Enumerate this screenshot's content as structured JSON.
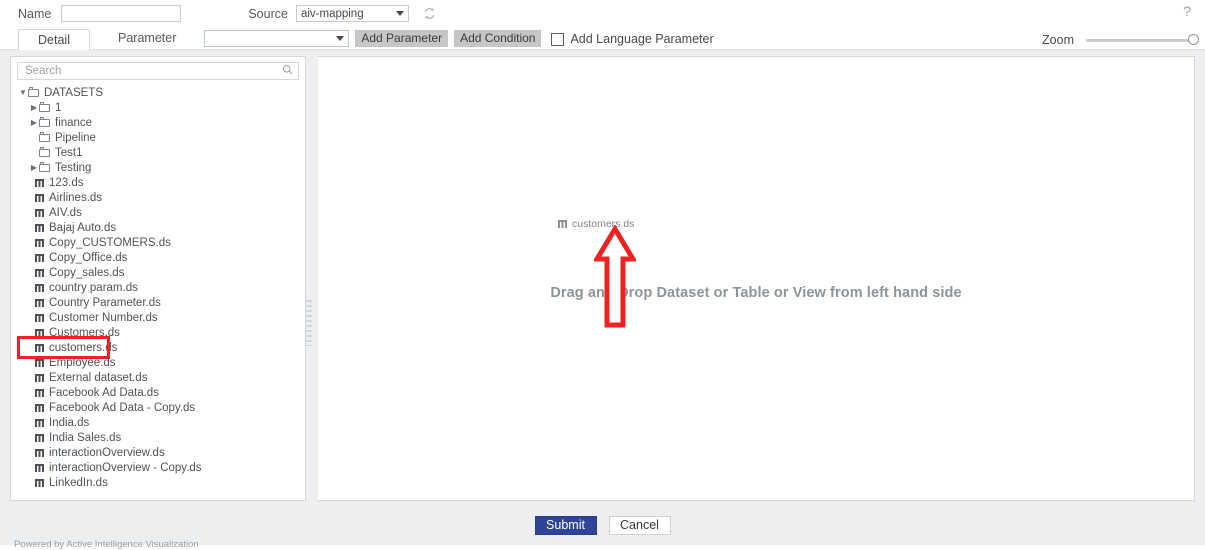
{
  "window": {
    "help_icon": "question-mark-icon",
    "powered_by": "Powered by Active Intelligence Visualization"
  },
  "topbar": {
    "name_label": "Name",
    "name_value": "",
    "name_placeholder": "",
    "source_label": "Source",
    "source_value": "aiv-mapping",
    "refresh_icon": "refresh-icon"
  },
  "tabs": {
    "detail_label": "Detail",
    "parameter_label": "Parameter",
    "parameter_select_value": "",
    "add_parameter_label": "Add Parameter",
    "add_condition_label": "Add Condition",
    "add_language_parameter_label": "Add Language Parameter",
    "add_language_parameter_checked": false
  },
  "zoom": {
    "label": "Zoom",
    "value": 100
  },
  "tree": {
    "search_placeholder": "Search",
    "search_value": "",
    "search_icon": "search-icon",
    "nodes": [
      {
        "label": "DATASETS",
        "type": "folder",
        "level": 0,
        "twist": "v"
      },
      {
        "label": "1",
        "type": "folder",
        "level": 1,
        "twist": ">"
      },
      {
        "label": "finance",
        "type": "folder",
        "level": 1,
        "twist": ">"
      },
      {
        "label": "Pipeline",
        "type": "folder",
        "level": 1,
        "twist": ""
      },
      {
        "label": "Test1",
        "type": "folder",
        "level": 1,
        "twist": ""
      },
      {
        "label": "Testing",
        "type": "folder",
        "level": 1,
        "twist": ">"
      },
      {
        "label": "123.ds",
        "type": "dataset",
        "level": 1,
        "twist": ""
      },
      {
        "label": "Airlines.ds",
        "type": "dataset",
        "level": 1,
        "twist": ""
      },
      {
        "label": "AIV.ds",
        "type": "dataset",
        "level": 1,
        "twist": ""
      },
      {
        "label": "Bajaj Auto.ds",
        "type": "dataset",
        "level": 1,
        "twist": ""
      },
      {
        "label": "Copy_CUSTOMERS.ds",
        "type": "dataset",
        "level": 1,
        "twist": ""
      },
      {
        "label": "Copy_Office.ds",
        "type": "dataset",
        "level": 1,
        "twist": ""
      },
      {
        "label": "Copy_sales.ds",
        "type": "dataset",
        "level": 1,
        "twist": ""
      },
      {
        "label": "country param.ds",
        "type": "dataset",
        "level": 1,
        "twist": ""
      },
      {
        "label": "Country Parameter.ds",
        "type": "dataset",
        "level": 1,
        "twist": ""
      },
      {
        "label": "Customer Number.ds",
        "type": "dataset",
        "level": 1,
        "twist": ""
      },
      {
        "label": "Customers.ds",
        "type": "dataset",
        "level": 1,
        "twist": ""
      },
      {
        "label": "customers.ds",
        "type": "dataset",
        "level": 1,
        "twist": "",
        "highlighted": true
      },
      {
        "label": "Employee.ds",
        "type": "dataset",
        "level": 1,
        "twist": ""
      },
      {
        "label": "External dataset.ds",
        "type": "dataset",
        "level": 1,
        "twist": ""
      },
      {
        "label": "Facebook Ad Data.ds",
        "type": "dataset",
        "level": 1,
        "twist": ""
      },
      {
        "label": "Facebook Ad Data - Copy.ds",
        "type": "dataset",
        "level": 1,
        "twist": ""
      },
      {
        "label": "India.ds",
        "type": "dataset",
        "level": 1,
        "twist": ""
      },
      {
        "label": "India Sales.ds",
        "type": "dataset",
        "level": 1,
        "twist": ""
      },
      {
        "label": "interactionOverview.ds",
        "type": "dataset",
        "level": 1,
        "twist": ""
      },
      {
        "label": "interactionOverview - Copy.ds",
        "type": "dataset",
        "level": 1,
        "twist": ""
      },
      {
        "label": "LinkedIn.ds",
        "type": "dataset",
        "level": 1,
        "twist": ""
      }
    ]
  },
  "canvas": {
    "hint_text": "Drag and Drop Dataset or Table or View from left hand side",
    "dropped_node_label": "customers.ds",
    "annotation_arrow_color": "#ee2222",
    "highlight_color": "#ee2222"
  },
  "footer": {
    "submit_label": "Submit",
    "cancel_label": "Cancel"
  }
}
